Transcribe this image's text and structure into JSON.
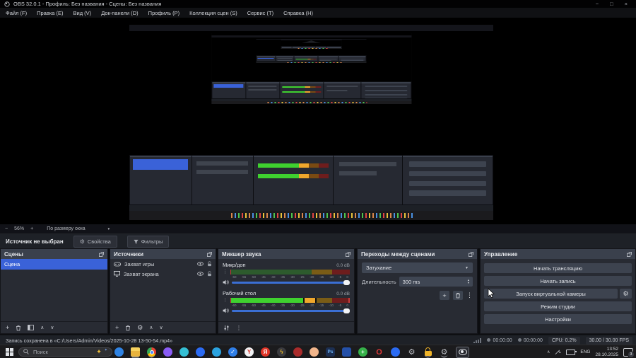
{
  "colors": {
    "accent_blue": "#3a62d8",
    "meter_green": "#3fd12f",
    "meter_orange": "#f0a72c",
    "meter_dim_green": "#2d5b2d",
    "meter_dim_orange": "#7a5c16",
    "meter_dim_red": "#6e1d1d",
    "volume_slider": "#3b6fd4",
    "panel_header": "#3a404c"
  },
  "window": {
    "title": "OBS 32.0.1 - Профиль: Без названия - Сцены: Без названия",
    "minimize": "−",
    "maximize": "□",
    "close": "×"
  },
  "menu": {
    "items": [
      "Файл (F)",
      "Правка (E)",
      "Вид (V)",
      "Док-панели (D)",
      "Профиль (P)",
      "Коллекция сцен (S)",
      "Сервис (T)",
      "Справка (H)"
    ]
  },
  "zoom_bar": {
    "zoom_out": "−",
    "zoom_value": "56%",
    "zoom_in": "+",
    "fit_label": "По размеру окна"
  },
  "source_bar": {
    "message": "Источник не выбран",
    "properties_label": "Свойства",
    "filters_label": "Фильтры"
  },
  "panels": {
    "scenes": {
      "title": "Сцены",
      "items": [
        "Сцена"
      ]
    },
    "sources": {
      "title": "Источники",
      "rows": [
        {
          "label": "Захват игры"
        },
        {
          "label": "Захват экрана"
        }
      ]
    },
    "mixer": {
      "title": "Микшер звука",
      "ticks": [
        "-60",
        "-55",
        "-50",
        "-45",
        "-40",
        "-35",
        "-30",
        "-25",
        "-20",
        "-15",
        "-10",
        "-5",
        "0"
      ],
      "channels": [
        {
          "name": "Микр/доп",
          "db": "0.0 dB",
          "segments": [
            {
              "c": "#c43b3b",
              "w": 0.8
            },
            {
              "c": "#2d5b2d",
              "w": 67.2
            },
            {
              "c": "#7a5c16",
              "w": 17
            },
            {
              "c": "#6e1d1d",
              "w": 15
            }
          ]
        },
        {
          "name": "Рабочий стол",
          "db": "0.0 dB",
          "segments": [
            {
              "c": "#c43b3b",
              "w": 0.8
            },
            {
              "c": "#3fd12f",
              "w": 60.2
            },
            {
              "c": "#0d0d0d",
              "w": 1
            },
            {
              "c": "#f0a72c",
              "w": 9
            },
            {
              "c": "#0d0d0d",
              "w": 1
            },
            {
              "c": "#7a5c16",
              "w": 13
            },
            {
              "c": "#6e1d1d",
              "w": 14
            },
            {
              "c": "#c43b3b",
              "w": 1
            }
          ]
        }
      ]
    },
    "transitions": {
      "title": "Переходы между сценами",
      "transition": "Затухание",
      "duration_label": "Длительность",
      "duration_value": "300 ms"
    },
    "controls": {
      "title": "Управление",
      "stream": "Начать трансляцию",
      "record": "Начать запись",
      "vcam": "Запуск виртуальной камеры",
      "studio": "Режим студии",
      "settings": "Настройки"
    }
  },
  "status_bar": {
    "message": "Запись сохранена в «C:/Users/Admin/Videos/2025-10-28 13-50-54.mp4»",
    "stream_time": "00:00:00",
    "rec_time": "00:00:00",
    "cpu": "CPU: 0.2%",
    "fps": "30.00 / 30.00 FPS"
  },
  "taskbar": {
    "search_placeholder": "Поиск",
    "apps": [
      {
        "name": "edge",
        "color": "#2f83e3",
        "glyph": ""
      },
      {
        "name": "file-explorer",
        "color": "#f3c84b",
        "glyph": "",
        "shape": "folder",
        "run": true
      },
      {
        "name": "chrome",
        "color": "#e8453c",
        "glyph": "",
        "shape": "chrome",
        "run": true
      },
      {
        "name": "purple-app",
        "color": "#8a5cf5",
        "glyph": ""
      },
      {
        "name": "compass-app",
        "color": "#35bfd4",
        "glyph": ""
      },
      {
        "name": "camera-app",
        "color": "#2b6bf3",
        "glyph": ""
      },
      {
        "name": "telegram",
        "color": "#2ba3e0",
        "glyph": ""
      },
      {
        "name": "check-app",
        "color": "#2f7fe8",
        "glyph": "✓"
      },
      {
        "name": "y-app",
        "color": "#f2f3f5",
        "glyph": "Y",
        "glyph_color": "#d93025"
      },
      {
        "name": "yandex-browser",
        "color": "#e03528",
        "glyph": "Я",
        "glyph_color": "#ffffff"
      },
      {
        "name": "lightning-app",
        "color": "#3a3a3e",
        "glyph": "ϟ",
        "glyph_color": "#f7c325"
      },
      {
        "name": "darkred-app",
        "color": "#a92b2b",
        "glyph": ""
      },
      {
        "name": "peach-app",
        "color": "#f2b68c",
        "glyph": ""
      },
      {
        "name": "photoshop",
        "color": "#1c2f52",
        "glyph": "Ps",
        "glyph_color": "#6fb5f7",
        "shape": "square"
      },
      {
        "name": "blue-square-app",
        "color": "#2450a8",
        "glyph": "",
        "shape": "square"
      },
      {
        "name": "green-app",
        "color": "#36b24a",
        "glyph": "+",
        "glyph_color": "#ffffff"
      },
      {
        "name": "opera",
        "color": "transparent",
        "glyph": "O",
        "glyph_color": "#e23838",
        "shape": "ring"
      },
      {
        "name": "camera-app-2",
        "color": "#2b6bf3",
        "glyph": ""
      },
      {
        "name": "settings-gear",
        "color": "transparent",
        "glyph": "⚙",
        "glyph_color": "#b8bbc1",
        "shape": "bare"
      },
      {
        "name": "lock-app",
        "color": "transparent",
        "glyph": "",
        "shape": "lock",
        "run": true
      },
      {
        "name": "settings-gear-2",
        "color": "transparent",
        "glyph": "⚙",
        "glyph_color": "#b8bbc1",
        "shape": "bare",
        "run": true
      },
      {
        "name": "obs-studio",
        "color": "#26282e",
        "glyph": "",
        "shape": "obs",
        "active": true
      }
    ],
    "tray": {
      "lang": "ENG",
      "time": "13:52",
      "date": "28.10.2025",
      "badge": "3"
    }
  },
  "icons": {
    "gear": "⚙",
    "kebab": "⋮",
    "plus": "+",
    "chevron_up": "∧",
    "chevron_down": "∨",
    "caret_down": "▼",
    "sparkle": "✦",
    "spin_up": "▴",
    "spin_down": "▾"
  }
}
